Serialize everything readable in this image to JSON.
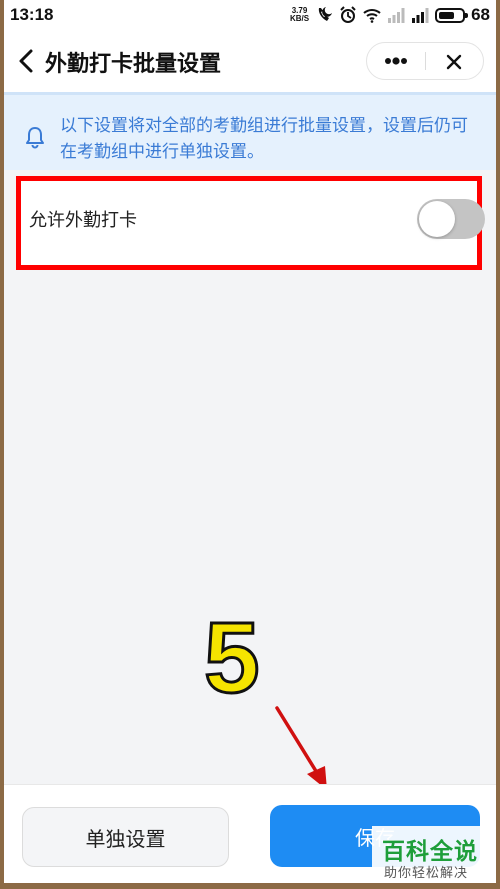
{
  "status_bar": {
    "time": "13:18",
    "net_speed_value": "3.79",
    "net_speed_unit": "KB/S",
    "battery": "68",
    "battery_level": 0.68
  },
  "nav": {
    "title": "外勤打卡批量设置"
  },
  "notice": {
    "text": "以下设置将对全部的考勤组进行批量设置，设置后仍可在考勤组中进行单独设置。"
  },
  "setting": {
    "label": "允许外勤打卡",
    "enabled": false
  },
  "annotation": {
    "step": "5"
  },
  "footer": {
    "single_label": "单独设置",
    "save_label": "保存"
  },
  "watermark": {
    "main": "百科全说",
    "sub": "助你轻松解决"
  },
  "colors": {
    "accent": "#1e8cf3",
    "notice_bg": "#e5f1fd",
    "notice_text": "#3a7bd5",
    "highlight": "#ff0000",
    "toggle_off": "#c4c4c4"
  }
}
